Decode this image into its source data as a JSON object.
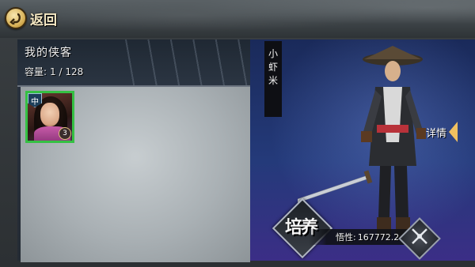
{
  "header": {
    "back_label": "返回"
  },
  "roster": {
    "title": "我的侠客",
    "capacity_label": "容量:",
    "capacity_value": "1 / 128",
    "characters": [
      {
        "rank": "中",
        "level": "3",
        "border_color": "#35c043"
      }
    ]
  },
  "hero": {
    "name_chars": [
      "小",
      "虾",
      "米"
    ],
    "detail_label": "详情",
    "train_label": "培养",
    "stat_label": "悟性:",
    "stat_value": "167772.2"
  },
  "colors": {
    "accent_gold": "#f0c060",
    "selection_green": "#35c043",
    "hero_bg": "#243a7a"
  },
  "icons": [
    "back-arrow-icon",
    "detail-arrow-icon",
    "crossed-swords-icon"
  ]
}
